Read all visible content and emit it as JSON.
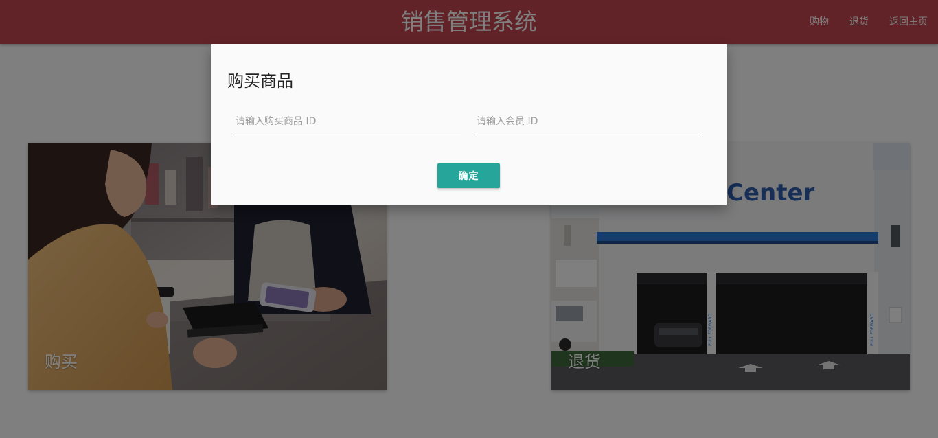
{
  "navbar": {
    "brand": "销售管理系统",
    "links": [
      {
        "label": "购物"
      },
      {
        "label": "退货"
      },
      {
        "label": "返回主页"
      }
    ],
    "color": "#c2474e"
  },
  "cards": {
    "buy": {
      "title": "购买",
      "image": "shopping-payment-photo"
    },
    "return": {
      "title": "退货",
      "image": "service-center-building-photo"
    }
  },
  "modal": {
    "title": "购买商品",
    "item_id_placeholder": "请输入购买商品 ID",
    "member_id_placeholder": "请输入会员 ID",
    "confirm_label": "确定",
    "confirm_color": "#26a69a"
  },
  "photo_text": {
    "sign": "Center",
    "pull_forward": "PULL FORWARD"
  }
}
